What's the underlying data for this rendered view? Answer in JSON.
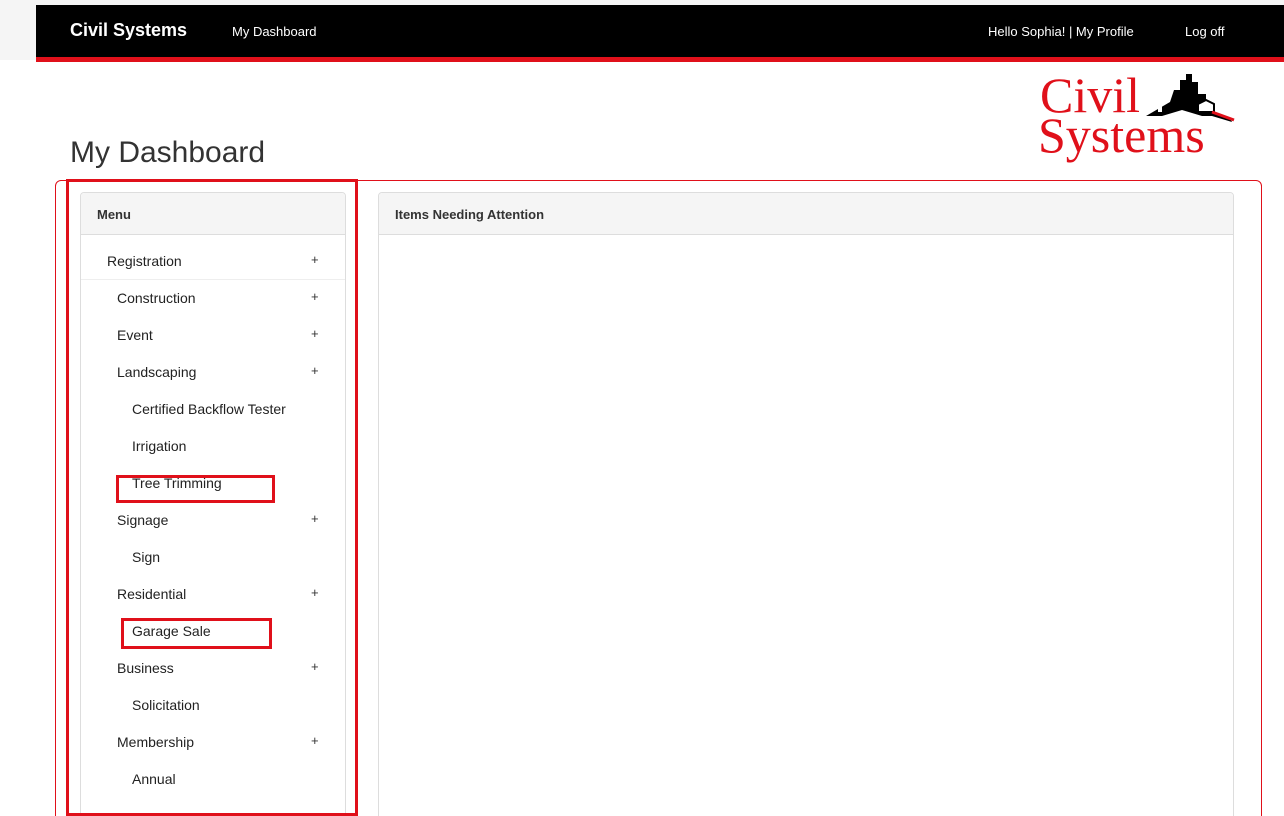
{
  "navbar": {
    "brand": "Civil Systems",
    "dashboard_link": "My Dashboard",
    "greeting": "Hello Sophia! | My Profile",
    "logoff": "Log off"
  },
  "logo": {
    "line1": "Civil",
    "line2": "Systems"
  },
  "page": {
    "title": "My Dashboard"
  },
  "menu": {
    "heading": "Menu",
    "items": [
      {
        "label": "Registration",
        "plus": "+"
      },
      {
        "label": "Construction",
        "plus": "+"
      },
      {
        "label": "Event",
        "plus": "+"
      },
      {
        "label": "Landscaping",
        "plus": "+"
      },
      {
        "label": "Certified Backflow Tester"
      },
      {
        "label": "Irrigation"
      },
      {
        "label": "Tree Trimming"
      },
      {
        "label": "Signage",
        "plus": "+"
      },
      {
        "label": "Sign"
      },
      {
        "label": "Residential",
        "plus": "+"
      },
      {
        "label": "Garage Sale"
      },
      {
        "label": "Business",
        "plus": "+"
      },
      {
        "label": "Solicitation"
      },
      {
        "label": "Membership",
        "plus": "+"
      },
      {
        "label": "Annual"
      }
    ]
  },
  "attention": {
    "heading": "Items Needing Attention"
  },
  "colors": {
    "accent": "#e0101a",
    "navbar": "#000000"
  }
}
